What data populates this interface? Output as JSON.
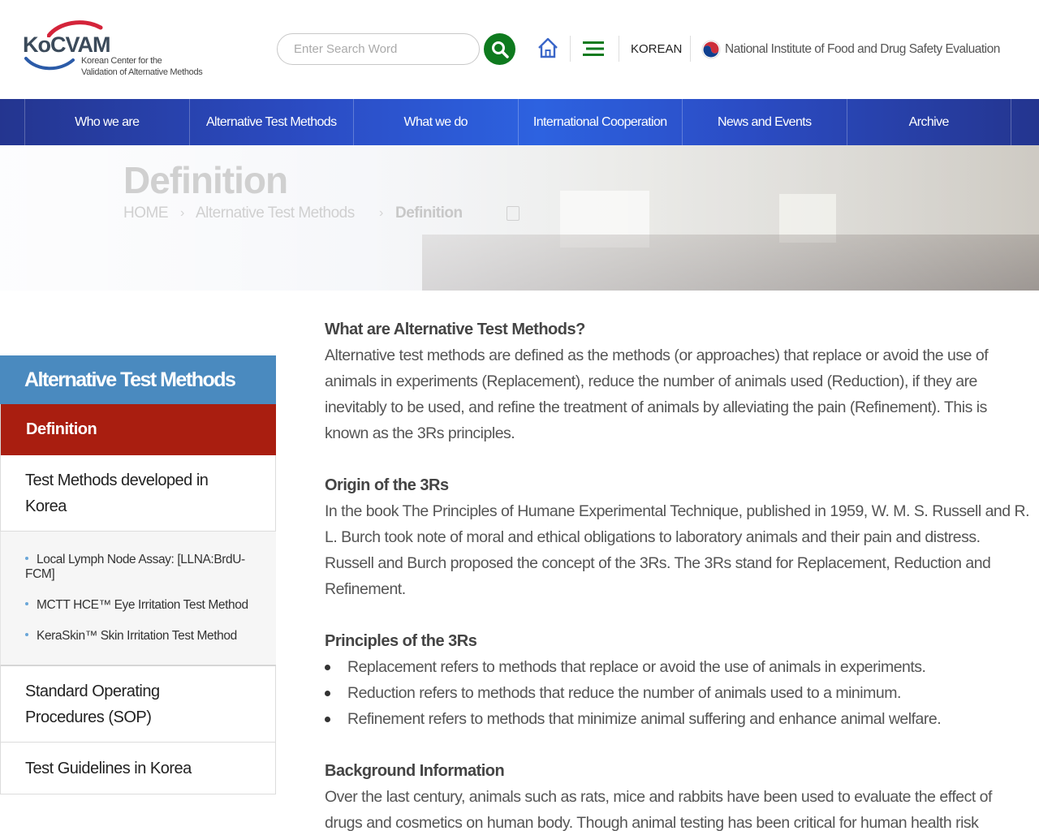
{
  "header": {
    "logo": {
      "name": "KoCVAM",
      "line1": "Korean Center for the",
      "line2": "Validation of Alternative Methods"
    },
    "search": {
      "placeholder": "Enter Search Word"
    },
    "language": "KOREAN",
    "agency": "National Institute of Food and Drug Safety Evaluation"
  },
  "nav": {
    "items": [
      {
        "label": "Who we are"
      },
      {
        "label": "Alternative Test Methods"
      },
      {
        "label": "What we do"
      },
      {
        "label": "International Cooperation"
      },
      {
        "label": "News and Events"
      },
      {
        "label": "Archive"
      }
    ]
  },
  "visual": {
    "page_title": "Definition",
    "breadcrumb": [
      "HOME",
      "Alternative Test Methods",
      "Definition"
    ]
  },
  "sidebar": {
    "title": "Alternative Test Methods",
    "active": "Definition",
    "item_korea": "Test Methods developed in Korea",
    "sub_items": [
      "Local Lymph Node Assay: [LLNA:BrdU-FCM]",
      "MCTT HCE™ Eye Irritation Test Method",
      "KeraSkin™ Skin Irritation Test Method"
    ],
    "item_sop": "Standard Operating Procedures (SOP)",
    "item_guidelines": "Test Guidelines in Korea"
  },
  "content": {
    "s1_heading": "What are Alternative Test Methods?",
    "s1_body": "Alternative test methods are defined as the methods (or approaches) that replace or avoid the use of animals in experiments (Replacement), reduce the number of animals used (Reduction), if they are inevitably to be used, and refine the treatment of animals by alleviating the pain (Refinement). This is known as the 3Rs principles.",
    "s2_heading": "Origin of the 3Rs",
    "s2_body": "In the book The Principles of Humane Experimental Technique, published in 1959, W. M. S. Russell and R. L. Burch took note of moral and ethical obligations to laboratory animals and their pain and distress. Russell and Burch proposed the concept of the 3Rs. The 3Rs stand for Replacement, Reduction and Refinement.",
    "s3_heading": "Principles of the 3Rs",
    "s3_bullets": [
      "Replacement refers to methods that replace or avoid the use of animals in experiments.",
      "Reduction refers to methods that reduce the number of animals used to a minimum.",
      "Refinement refers to methods that minimize animal suffering and enhance animal welfare."
    ],
    "s4_heading": "Background Information",
    "s4_body": "Over the last century, animals such as rats, mice and rabbits have been used to evaluate the effect of drugs and cosmetics on human body. Though animal testing has been critical for human health risk"
  },
  "colors": {
    "nav_gradient_mid": "#2d62e0",
    "nav_gradient_edge": "#24358f",
    "search_button": "#0e7a1e",
    "sidebar_title": "#4a8abf",
    "sidebar_active": "#a91e10"
  }
}
